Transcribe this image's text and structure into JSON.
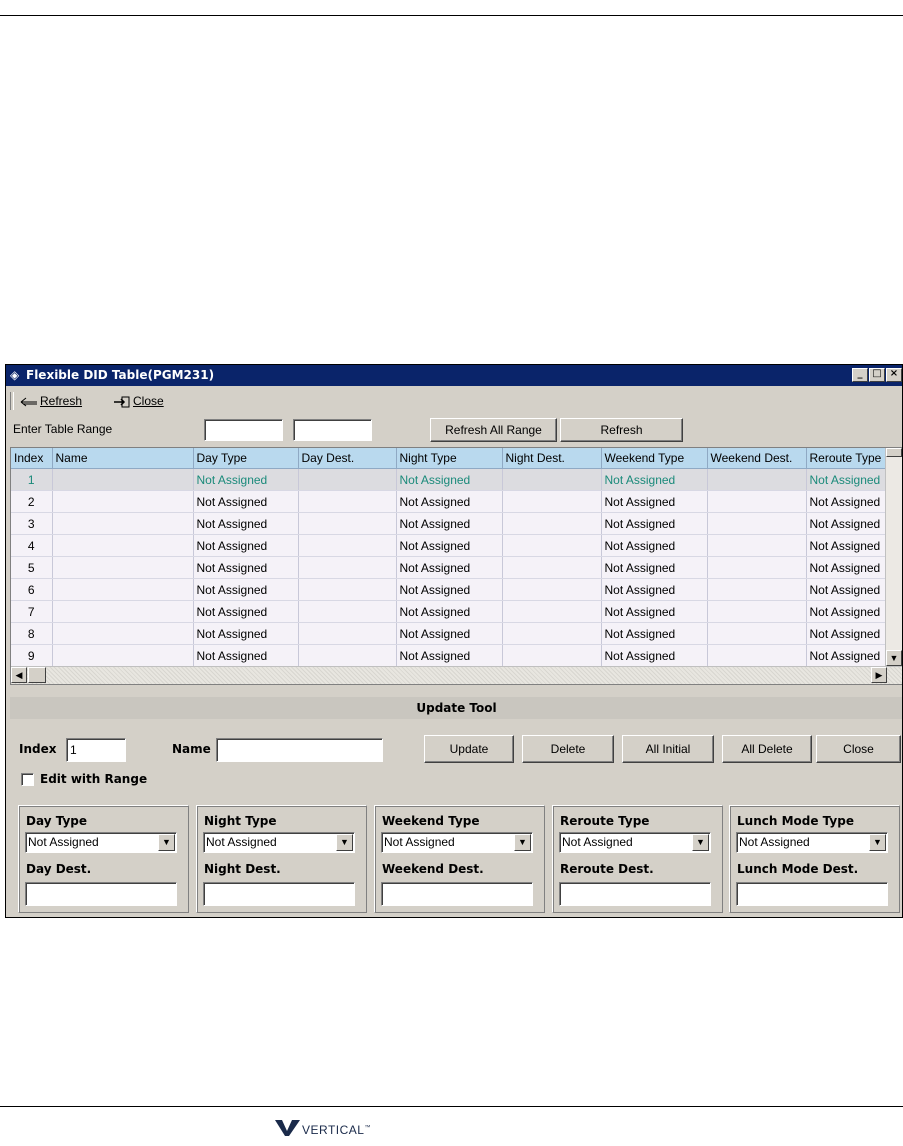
{
  "window": {
    "title": "Flexible DID Table(PGM231)",
    "controls": {
      "minimize": "_",
      "maximize": "□",
      "close": "×"
    }
  },
  "toolbar": {
    "refresh_label": "Refresh",
    "close_label": "Close",
    "refresh_icon": "arrow-left-icon",
    "close_icon": "exit-icon"
  },
  "range": {
    "label": "Enter Table Range",
    "from_value": "",
    "to_value": "",
    "refresh_all_label": "Refresh All Range",
    "refresh_label": "Refresh"
  },
  "table": {
    "columns": [
      "Index",
      "Name",
      "Day Type",
      "Day Dest.",
      "Night Type",
      "Night Dest.",
      "Weekend Type",
      "Weekend Dest.",
      "Reroute Type"
    ],
    "rows": [
      [
        "1",
        "",
        "Not Assigned",
        "",
        "Not Assigned",
        "",
        "Not Assigned",
        "",
        "Not Assigned"
      ],
      [
        "2",
        "",
        "Not Assigned",
        "",
        "Not Assigned",
        "",
        "Not Assigned",
        "",
        "Not Assigned"
      ],
      [
        "3",
        "",
        "Not Assigned",
        "",
        "Not Assigned",
        "",
        "Not Assigned",
        "",
        "Not Assigned"
      ],
      [
        "4",
        "",
        "Not Assigned",
        "",
        "Not Assigned",
        "",
        "Not Assigned",
        "",
        "Not Assigned"
      ],
      [
        "5",
        "",
        "Not Assigned",
        "",
        "Not Assigned",
        "",
        "Not Assigned",
        "",
        "Not Assigned"
      ],
      [
        "6",
        "",
        "Not Assigned",
        "",
        "Not Assigned",
        "",
        "Not Assigned",
        "",
        "Not Assigned"
      ],
      [
        "7",
        "",
        "Not Assigned",
        "",
        "Not Assigned",
        "",
        "Not Assigned",
        "",
        "Not Assigned"
      ],
      [
        "8",
        "",
        "Not Assigned",
        "",
        "Not Assigned",
        "",
        "Not Assigned",
        "",
        "Not Assigned"
      ],
      [
        "9",
        "",
        "Not Assigned",
        "",
        "Not Assigned",
        "",
        "Not Assigned",
        "",
        "Not Assigned"
      ]
    ],
    "selected_row": 0,
    "selected_color": "#1a8a7a"
  },
  "update_tool": {
    "header": "Update Tool",
    "index_label": "Index",
    "index_value": "1",
    "name_label": "Name",
    "name_value": "",
    "buttons": {
      "update": "Update",
      "delete": "Delete",
      "all_initial": "All Initial",
      "all_delete": "All Delete",
      "close": "Close"
    },
    "edit_with_range_label": "Edit with Range",
    "groups": [
      {
        "type_label": "Day Type",
        "type_value": "Not Assigned",
        "dest_label": "Day Dest.",
        "dest_value": ""
      },
      {
        "type_label": "Night Type",
        "type_value": "Not Assigned",
        "dest_label": "Night Dest.",
        "dest_value": ""
      },
      {
        "type_label": "Weekend Type",
        "type_value": "Not Assigned",
        "dest_label": "Weekend Dest.",
        "dest_value": ""
      },
      {
        "type_label": "Reroute Type",
        "type_value": "Not Assigned",
        "dest_label": "Reroute Dest.",
        "dest_value": ""
      },
      {
        "type_label": "Lunch Mode Type",
        "type_value": "Not Assigned",
        "dest_label": "Lunch Mode Dest.",
        "dest_value": ""
      }
    ]
  },
  "footer": {
    "logo_text": "VERTICAL",
    "logo_mark": "™",
    "logo_color": "#1a2a4a"
  },
  "colors": {
    "titlebar": "#0a246a",
    "header_bg": "#b9d9ee",
    "window_bg": "#d4d0c8"
  }
}
